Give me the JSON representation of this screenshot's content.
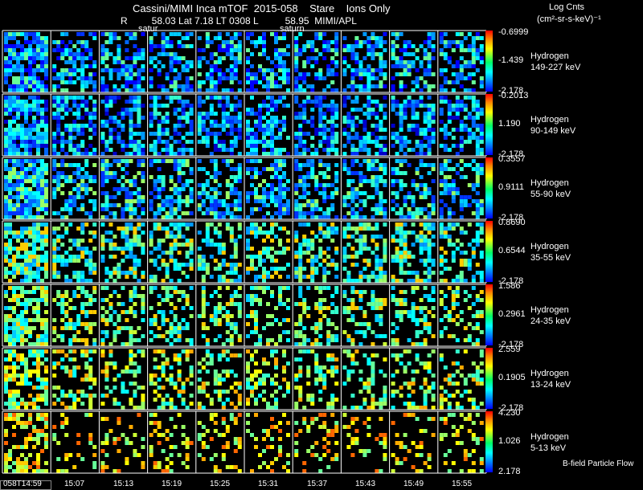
{
  "header": {
    "title": "Cassini/MIMI Inca mTOF  2015-058    Stare    Ions Only",
    "subtitle": "R         58.03 Lat 7.18 LT 0308 L          58.95  MIMI/APL",
    "log_counts": "Log Cnts",
    "log_units": "(cm²-sr-s-keV)⁻¹",
    "saturn_labels": [
      "satur",
      "saturn"
    ]
  },
  "panels": [
    {
      "species": "Hydrogen",
      "range": "149-227 keV",
      "cmax": "-0.6999",
      "cmid": "-1.439",
      "cmin": "-2.178"
    },
    {
      "species": "Hydrogen",
      "range": "90-149 keV",
      "cmax": "-0.2013",
      "cmid": "1.190",
      "cmin": "-2.178"
    },
    {
      "species": "Hydrogen",
      "range": "55-90 keV",
      "cmax": "0.3557",
      "cmid": "0.9111",
      "cmin": "-2.178"
    },
    {
      "species": "Hydrogen",
      "range": "35-55 keV",
      "cmax": "0.8690",
      "cmid": "0.6544",
      "cmin": "-2.178"
    },
    {
      "species": "Hydrogen",
      "range": "24-35 keV",
      "cmax": "1.586",
      "cmid": "0.2961",
      "cmin": "-2.178"
    },
    {
      "species": "Hydrogen",
      "range": "13-24 keV",
      "cmax": "2.559",
      "cmid": "0.1905",
      "cmin": "-2.178"
    },
    {
      "species": "Hydrogen",
      "range": "5-13 keV",
      "cmax": "4.230",
      "cmid": "1.026",
      "cmin": "2.178"
    }
  ],
  "time_labels": [
    "058T14:59",
    "15:07",
    "15:13",
    "15:19",
    "15:25",
    "15:31",
    "15:37",
    "15:43",
    "15:49",
    "15:55"
  ],
  "footer": {
    "bfield": "B-field Particle Flow"
  }
}
